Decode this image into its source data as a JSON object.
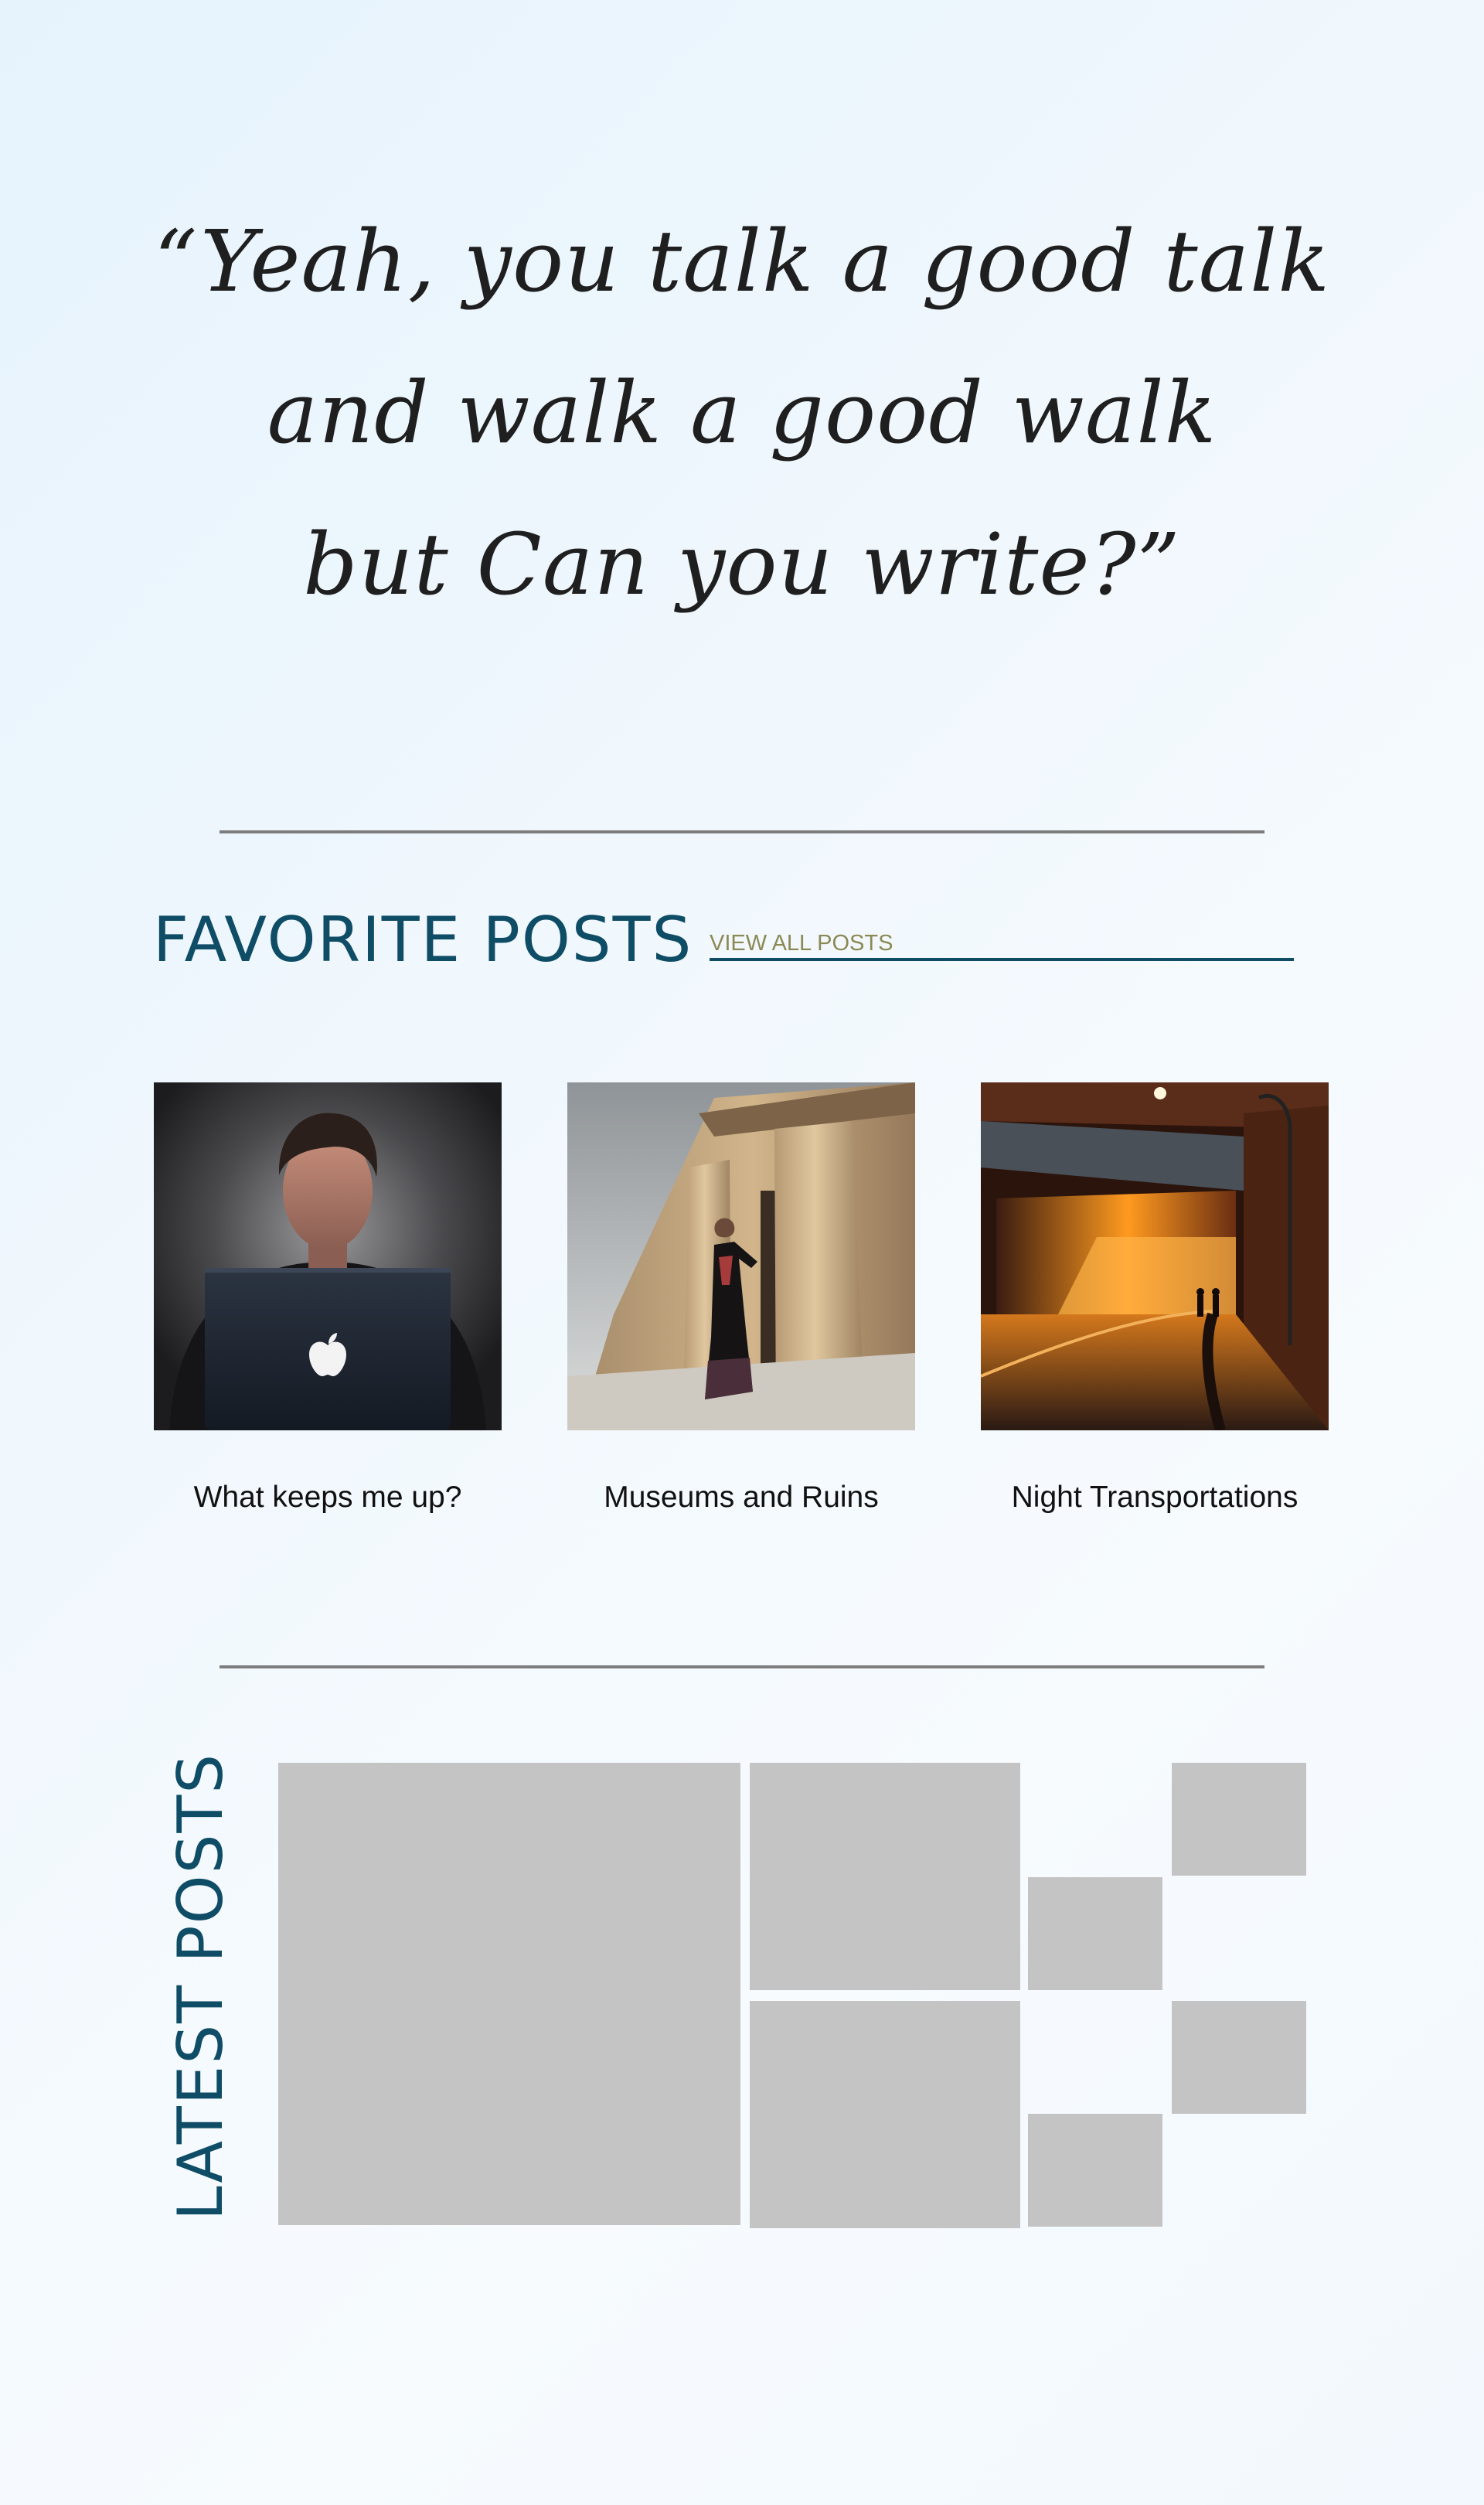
{
  "quote": {
    "lines": [
      "“Yeah, you talk a good talk",
      "and walk a good walk",
      "but Can you write?”"
    ]
  },
  "favorite_posts": {
    "title": "FAVORITE POSTS",
    "view_all": "VIEW ALL POSTS",
    "posts": [
      {
        "title": "What keeps me up?",
        "image": "person-with-laptop-photo"
      },
      {
        "title": "Museums and Ruins",
        "image": "woman-at-ancient-ruins-photo"
      },
      {
        "title": "Night Transportations",
        "image": "night-tunnel-photo"
      }
    ]
  },
  "latest_posts": {
    "title": "LATEST POSTS",
    "tile_count": 7
  },
  "colors": {
    "accent": "#0f4c66",
    "link": "#8b8a55",
    "divider": "#7d7d7d",
    "placeholder": "#c4c4c4"
  }
}
